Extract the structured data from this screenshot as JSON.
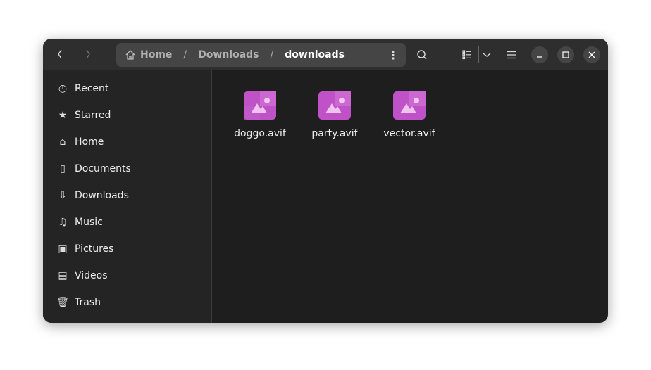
{
  "header": {
    "breadcrumbs": [
      "Home",
      "Downloads",
      "downloads"
    ],
    "separator": "/"
  },
  "sidebar": {
    "items": [
      {
        "label": "Recent",
        "icon": "clock-icon"
      },
      {
        "label": "Starred",
        "icon": "star-icon"
      },
      {
        "label": "Home",
        "icon": "home-icon"
      },
      {
        "label": "Documents",
        "icon": "document-icon"
      },
      {
        "label": "Downloads",
        "icon": "download-icon"
      },
      {
        "label": "Music",
        "icon": "music-icon"
      },
      {
        "label": "Pictures",
        "icon": "picture-icon"
      },
      {
        "label": "Videos",
        "icon": "film-icon"
      },
      {
        "label": "Trash",
        "icon": "trash-icon"
      }
    ]
  },
  "files": [
    {
      "name": "doggo.avif",
      "icon": "image-file-icon"
    },
    {
      "name": "party.avif",
      "icon": "image-file-icon"
    },
    {
      "name": "vector.avif",
      "icon": "image-file-icon"
    }
  ],
  "colors": {
    "icon_purple": "#b041c0",
    "accent_light": "#d97ed8"
  }
}
